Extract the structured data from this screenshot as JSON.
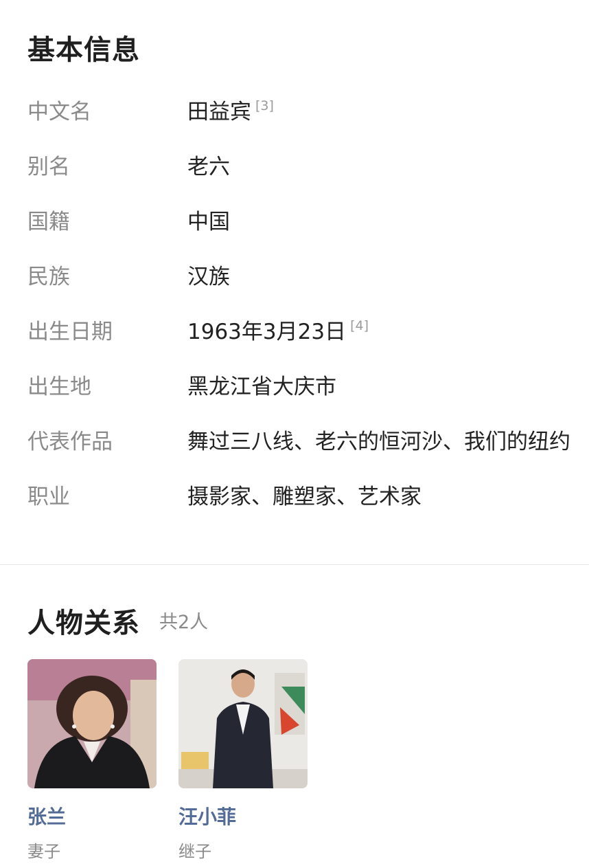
{
  "basic_info": {
    "title": "基本信息",
    "rows": [
      {
        "label": "中文名",
        "value": "田益宾",
        "ref": "[3]"
      },
      {
        "label": "别名",
        "value": "老六"
      },
      {
        "label": "国籍",
        "value": "中国"
      },
      {
        "label": "民族",
        "value": "汉族"
      },
      {
        "label": "出生日期",
        "value": "1963年3月23日",
        "ref": "[4]"
      },
      {
        "label": "出生地",
        "value": "黑龙江省大庆市"
      },
      {
        "label": "代表作品",
        "value": "舞过三八线、老六的恒河沙、我们的纽约"
      },
      {
        "label": "职业",
        "value": "摄影家、雕塑家、艺术家"
      }
    ]
  },
  "relations": {
    "title": "人物关系",
    "count": "共2人",
    "people": [
      {
        "name": "张兰",
        "role": "妻子"
      },
      {
        "name": "汪小菲",
        "role": "继子"
      }
    ]
  },
  "colors": {
    "name_link": "#536c97",
    "label_gray": "#8a8a8a"
  }
}
